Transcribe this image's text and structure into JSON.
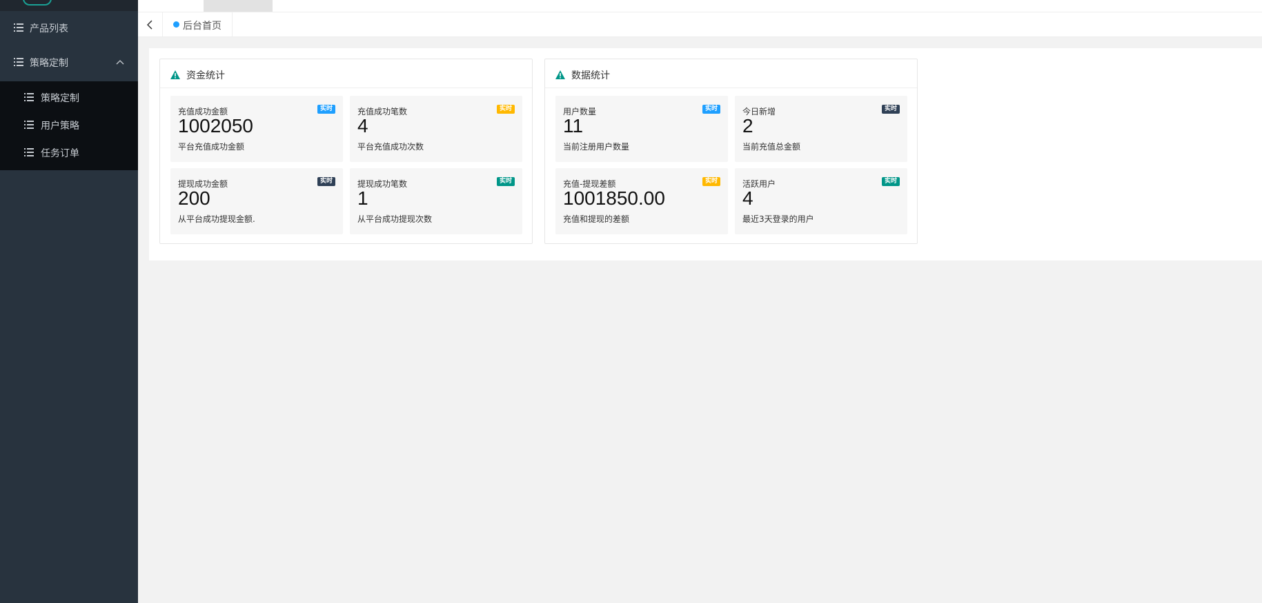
{
  "sidebar": {
    "items": [
      {
        "label": "产品列表"
      },
      {
        "label": "策略定制"
      }
    ],
    "submenu": [
      {
        "label": "策略定制"
      },
      {
        "label": "用户策略"
      },
      {
        "label": "任务订单"
      }
    ]
  },
  "tabs": {
    "home_label": "后台首页"
  },
  "colors": {
    "sidebar_bg": "#28333e",
    "submenu_bg": "#0c0f13",
    "accent": "#1aa094",
    "tab_dot": "#1e9fff",
    "badge_blue": "#1e9fff",
    "badge_orange": "#ffb800",
    "badge_dark": "#2f4056",
    "badge_green": "#009688"
  },
  "cards": [
    {
      "title": "资金统计",
      "stats": [
        {
          "title": "充值成功金额",
          "value": "1002050",
          "desc": "平台充值成功金额",
          "badge": "实时",
          "badge_color": "#1e9fff"
        },
        {
          "title": "充值成功笔数",
          "value": "4",
          "desc": "平台充值成功次数",
          "badge": "实时",
          "badge_color": "#ffb800"
        },
        {
          "title": "提现成功金额",
          "value": "200",
          "desc": "从平台成功提现金额.",
          "badge": "实时",
          "badge_color": "#2f4056"
        },
        {
          "title": "提现成功笔数",
          "value": "1",
          "desc": "从平台成功提现次数",
          "badge": "实时",
          "badge_color": "#009688"
        }
      ]
    },
    {
      "title": "数据统计",
      "stats": [
        {
          "title": "用户数量",
          "value": "11",
          "desc": "当前注册用户数量",
          "badge": "实时",
          "badge_color": "#1e9fff"
        },
        {
          "title": "今日新增",
          "value": "2",
          "desc": "当前充值总金额",
          "badge": "实时",
          "badge_color": "#2f4056"
        },
        {
          "title": "充值-提现差额",
          "value": "1001850.00",
          "desc": "充值和提现的差额",
          "badge": "实时",
          "badge_color": "#ffb800"
        },
        {
          "title": "活跃用户",
          "value": "4",
          "desc": "最近3天登录的用户",
          "badge": "实时",
          "badge_color": "#009688"
        }
      ]
    }
  ]
}
